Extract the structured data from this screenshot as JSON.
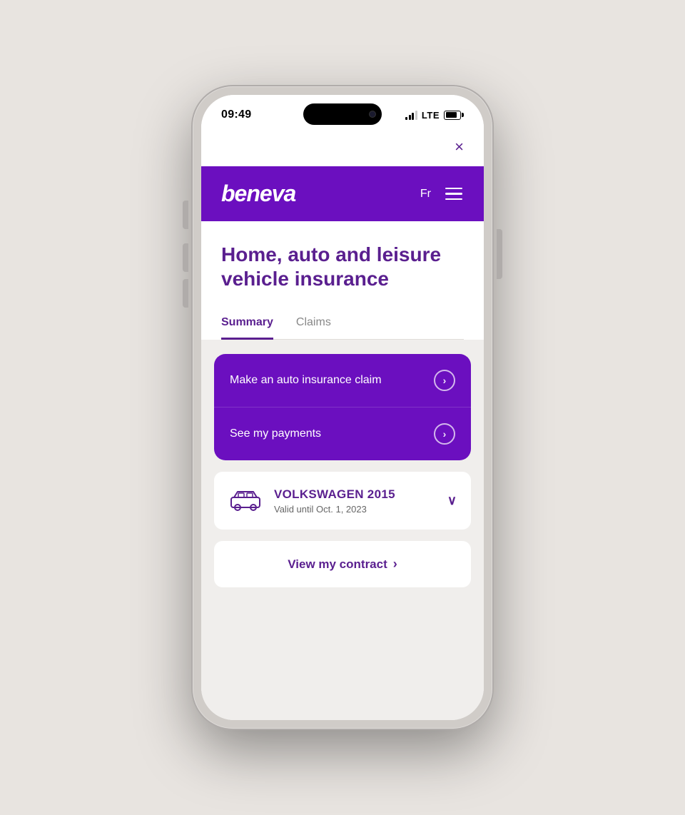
{
  "phone": {
    "status_bar": {
      "time": "09:49",
      "lte": "LTE"
    },
    "close_button": "×"
  },
  "header": {
    "logo": "beneva",
    "lang": "Fr",
    "menu_label": "menu"
  },
  "page": {
    "title": "Home, auto and leisure vehicle insurance",
    "tabs": [
      {
        "label": "Summary",
        "active": true
      },
      {
        "label": "Claims",
        "active": false
      }
    ],
    "actions": [
      {
        "label": "Make an auto insurance claim"
      },
      {
        "label": "See my payments"
      }
    ],
    "vehicle": {
      "name": "VOLKSWAGEN 2015",
      "valid_until": "Valid until Oct. 1, 2023"
    },
    "view_contract": "View my contract"
  }
}
